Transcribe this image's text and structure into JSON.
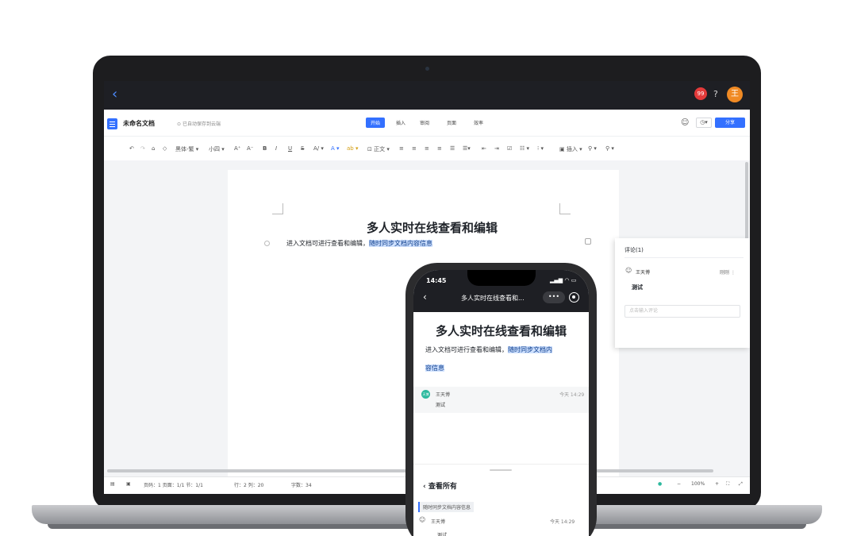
{
  "app": {
    "notification_count": "99",
    "help": "?",
    "user_initial": "王"
  },
  "doc": {
    "name": "未命名文档",
    "save_status": "已自动保存到云端",
    "title": "多人实时在线查看和编辑",
    "body_plain": "进入文档可进行查看和编辑，",
    "body_highlight": "随时同步文档内容信息"
  },
  "tabs": [
    {
      "label": "开始",
      "active": true
    },
    {
      "label": "插入"
    },
    {
      "label": "审阅"
    },
    {
      "label": "页面"
    },
    {
      "label": "效率"
    }
  ],
  "share_label": "分享",
  "toolbar": {
    "font": "黑体-繁",
    "size": "小四",
    "bold": "B",
    "italic": "I",
    "underline": "U",
    "strike": "S",
    "style": "正文",
    "insert": "插入"
  },
  "comment_panel": {
    "title": "评论(1)",
    "user": "王天博",
    "time": "刚刚",
    "text": "测试",
    "input_placeholder": "点击输入评论"
  },
  "statusbar": {
    "page_info": "页码：1  页面：1/1  节：1/1",
    "position": "行：2  列：20",
    "word_count": "字数：34",
    "zoom": "100%",
    "zoom_out": "−",
    "zoom_in": "+"
  },
  "phone": {
    "time": "14:45",
    "title": "多人实时在线查看和...",
    "more": "•••",
    "doc_title": "多人实时在线查看和编辑",
    "body_plain": "进入文档可进行查看和编辑，",
    "body_highlight_1": "随时同步文档内",
    "body_highlight_2": "容信息",
    "comment_avatar": "天博",
    "comment_user": "王天博",
    "comment_time": "今天 14:29",
    "comment_text": "测试",
    "sheet_title": "查看所有",
    "quote": "随时同步文档内容信息",
    "sheet_user": "王天博",
    "sheet_time": "今天 14:29",
    "sheet_text": "测试"
  },
  "colors": {
    "accent": "#3370ff",
    "dark_bar": "#1e1f24",
    "avatar": "#f08a24",
    "highlight": "#cfe1ff"
  }
}
